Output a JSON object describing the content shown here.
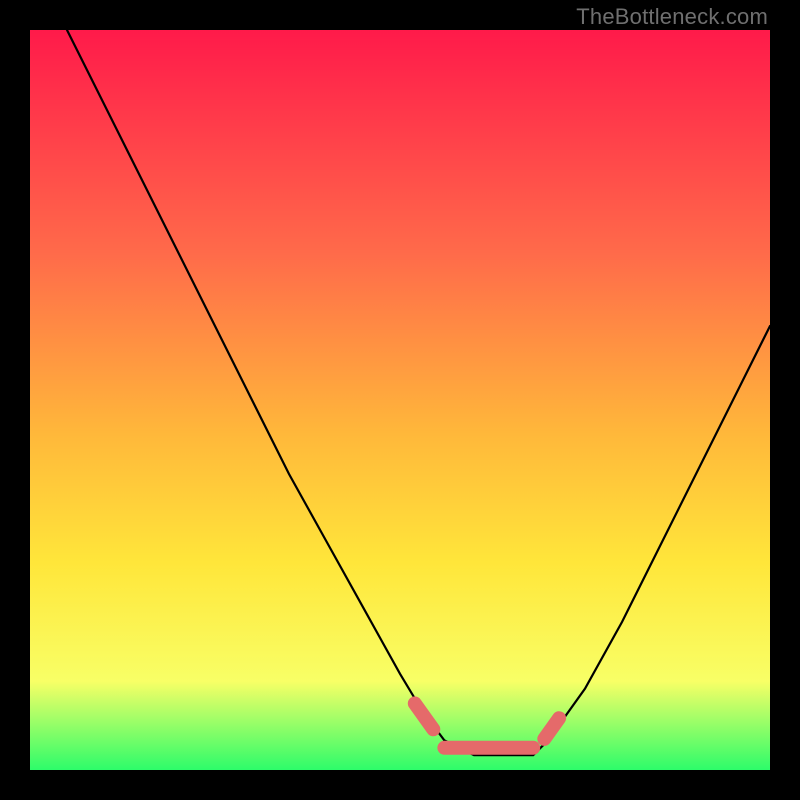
{
  "watermark": "TheBottleneck.com",
  "gradient": {
    "c0": "#ff1a4a",
    "c1": "#ff6a4a",
    "c2": "#ffb93a",
    "c3": "#ffe63a",
    "c4": "#f8ff66",
    "c5": "#2dfc6a"
  },
  "chart_data": {
    "type": "line",
    "title": "",
    "xlabel": "",
    "ylabel": "",
    "xlim": [
      0,
      100
    ],
    "ylim": [
      0,
      100
    ],
    "series": [
      {
        "name": "bottleneck-curve",
        "x": [
          5,
          10,
          15,
          20,
          25,
          30,
          35,
          40,
          45,
          50,
          53,
          56,
          60,
          64,
          68,
          70,
          75,
          80,
          85,
          90,
          95,
          100
        ],
        "values": [
          100,
          90,
          80,
          70,
          60,
          50,
          40,
          31,
          22,
          13,
          8,
          4,
          2,
          2,
          2,
          4,
          11,
          20,
          30,
          40,
          50,
          60
        ]
      }
    ],
    "marker_band": {
      "name": "optimal-range",
      "color": "#e56a6a",
      "segments": [
        {
          "x": [
            52,
            54.5
          ],
          "y": [
            9,
            5.5
          ]
        },
        {
          "x": [
            56,
            68
          ],
          "y": [
            3,
            3
          ]
        },
        {
          "x": [
            69.5,
            71.5
          ],
          "y": [
            4.2,
            7
          ]
        }
      ]
    }
  }
}
